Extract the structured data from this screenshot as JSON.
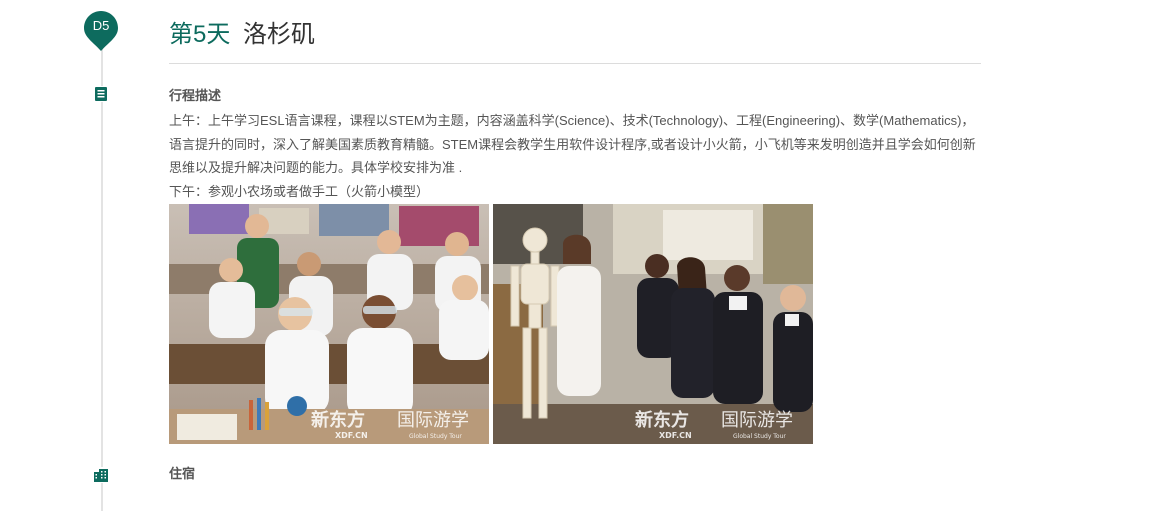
{
  "day": {
    "badge": "D5",
    "title": "第5天",
    "city": "洛杉矶"
  },
  "schedule": {
    "heading": "行程描述",
    "morning": "上午：上午学习ESL语言课程，课程以STEM为主题，内容涵盖科学(Science)、技术(Technology)、工程(Engineering)、数学(Mathematics)，语言提升的同时，深入了解美国素质教育精髓。STEM课程会教学生用软件设计程序,或者设计小火箭，小飞机等来发明创造并且学会如何创新思维以及提升解决问题的能力。具体学校安排为准 .",
    "afternoon": "下午：参观小农场或者做手工（火箭小模型）"
  },
  "photos": [
    {
      "watermark_cn": "新东方",
      "watermark_cn2": "国际游学",
      "watermark_en": "XDF.CN",
      "watermark_en2": "Global Study Tour"
    },
    {
      "watermark_cn": "新东方",
      "watermark_cn2": "国际游学",
      "watermark_en": "XDF.CN",
      "watermark_en2": "Global Study Tour"
    }
  ],
  "lodging": {
    "heading": "住宿"
  },
  "colors": {
    "accent": "#0d6b5e",
    "timeline": "#e3e3e3"
  },
  "icons": {
    "schedule": "document-icon",
    "lodging": "building-icon"
  }
}
